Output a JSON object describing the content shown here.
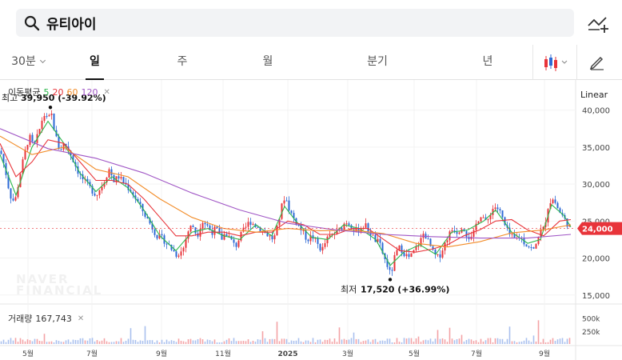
{
  "search": {
    "query": "유티아이",
    "icon": "search-icon"
  },
  "header": {
    "compare_icon": "chart-compare-icon"
  },
  "tabs": [
    {
      "label": "30분",
      "dropdown": true
    },
    {
      "label": "일",
      "active": true
    },
    {
      "label": "주"
    },
    {
      "label": "월"
    },
    {
      "label": "분기"
    },
    {
      "label": "년"
    }
  ],
  "tools": {
    "chart_type_icon": "candlestick-icon",
    "draw_icon": "pencil-icon"
  },
  "scale": {
    "label": "Linear"
  },
  "ma_legend": {
    "label": "이동평균",
    "items": [
      {
        "label": "5",
        "color": "#2db84c"
      },
      {
        "label": "20",
        "color": "#e8343a"
      },
      {
        "label": "60",
        "color": "#f28c28"
      },
      {
        "label": "120",
        "color": "#a056c5"
      }
    ]
  },
  "volume_legend": {
    "label": "거래량",
    "value": "167,743"
  },
  "watermark": {
    "line1": "NAVER",
    "line2": "FINANCIAL"
  },
  "chart_data": {
    "type": "candlestick",
    "ylim": [
      14000,
      43000
    ],
    "y_ticks": [
      {
        "label": "40,000",
        "value": 40000
      },
      {
        "label": "35,000",
        "value": 35000
      },
      {
        "label": "30,000",
        "value": 30000
      },
      {
        "label": "25,000",
        "value": 25000
      },
      {
        "label": "20,000",
        "value": 20000
      },
      {
        "label": "15,000",
        "value": 15000
      }
    ],
    "x_ticks": [
      {
        "label": "5월",
        "x": 35
      },
      {
        "label": "7월",
        "x": 115
      },
      {
        "label": "9월",
        "x": 202
      },
      {
        "label": "11월",
        "x": 279
      },
      {
        "label": "2025",
        "x": 360,
        "bold": true
      },
      {
        "label": "3월",
        "x": 435
      },
      {
        "label": "5월",
        "x": 518
      },
      {
        "label": "7월",
        "x": 596
      },
      {
        "label": "9월",
        "x": 681
      }
    ],
    "x_range": [
      0,
      718
    ],
    "current_price": {
      "label": "24,000",
      "value": 24000,
      "color": "#e8343a"
    },
    "high": {
      "label": "최고",
      "value_label": "39,950 (-39.92%)",
      "value": 39950,
      "x": 63
    },
    "low": {
      "label": "최저",
      "value_label": "17,520 (+36.99%)",
      "value": 17520,
      "x": 488
    },
    "volume_ticks": [
      {
        "label": "500k",
        "value": 500000
      },
      {
        "label": "250k",
        "value": 250000
      }
    ],
    "volume_max": 620000,
    "price_anchors": [
      [
        0,
        34500
      ],
      [
        6,
        32000
      ],
      [
        12,
        28500
      ],
      [
        18,
        27500
      ],
      [
        24,
        31000
      ],
      [
        30,
        34000
      ],
      [
        36,
        36500
      ],
      [
        42,
        35000
      ],
      [
        48,
        37000
      ],
      [
        54,
        39500
      ],
      [
        60,
        38500
      ],
      [
        63,
        39950
      ],
      [
        68,
        37000
      ],
      [
        74,
        34500
      ],
      [
        80,
        35500
      ],
      [
        86,
        34500
      ],
      [
        92,
        33000
      ],
      [
        98,
        31500
      ],
      [
        104,
        30500
      ],
      [
        112,
        29500
      ],
      [
        120,
        28500
      ],
      [
        128,
        30000
      ],
      [
        136,
        32000
      ],
      [
        142,
        30500
      ],
      [
        148,
        31000
      ],
      [
        156,
        30000
      ],
      [
        164,
        29000
      ],
      [
        172,
        27500
      ],
      [
        180,
        26000
      ],
      [
        188,
        24500
      ],
      [
        196,
        23000
      ],
      [
        204,
        22500
      ],
      [
        212,
        21500
      ],
      [
        220,
        20500
      ],
      [
        228,
        21000
      ],
      [
        234,
        23500
      ],
      [
        240,
        24500
      ],
      [
        246,
        23000
      ],
      [
        252,
        25000
      ],
      [
        258,
        24500
      ],
      [
        264,
        23500
      ],
      [
        270,
        24000
      ],
      [
        276,
        22500
      ],
      [
        282,
        23500
      ],
      [
        288,
        22500
      ],
      [
        294,
        21500
      ],
      [
        300,
        23000
      ],
      [
        306,
        24000
      ],
      [
        312,
        25000
      ],
      [
        318,
        24500
      ],
      [
        324,
        24000
      ],
      [
        330,
        23500
      ],
      [
        336,
        23000
      ],
      [
        342,
        22500
      ],
      [
        346,
        24000
      ],
      [
        352,
        27000
      ],
      [
        356,
        28500
      ],
      [
        360,
        27000
      ],
      [
        366,
        25500
      ],
      [
        372,
        24500
      ],
      [
        378,
        23500
      ],
      [
        384,
        22500
      ],
      [
        390,
        23000
      ],
      [
        396,
        22000
      ],
      [
        402,
        21000
      ],
      [
        408,
        22500
      ],
      [
        414,
        23000
      ],
      [
        420,
        23500
      ],
      [
        426,
        24000
      ],
      [
        432,
        25000
      ],
      [
        438,
        24500
      ],
      [
        444,
        23500
      ],
      [
        450,
        24000
      ],
      [
        456,
        24500
      ],
      [
        462,
        23500
      ],
      [
        468,
        22500
      ],
      [
        474,
        22000
      ],
      [
        480,
        20000
      ],
      [
        486,
        18500
      ],
      [
        488,
        17520
      ],
      [
        494,
        20500
      ],
      [
        500,
        21500
      ],
      [
        506,
        20500
      ],
      [
        512,
        20000
      ],
      [
        518,
        21000
      ],
      [
        524,
        22000
      ],
      [
        530,
        23500
      ],
      [
        536,
        22000
      ],
      [
        542,
        20500
      ],
      [
        548,
        20000
      ],
      [
        554,
        21500
      ],
      [
        560,
        23000
      ],
      [
        566,
        24000
      ],
      [
        572,
        23500
      ],
      [
        578,
        24500
      ],
      [
        584,
        23000
      ],
      [
        590,
        22500
      ],
      [
        596,
        25000
      ],
      [
        602,
        26000
      ],
      [
        608,
        24500
      ],
      [
        614,
        26500
      ],
      [
        620,
        27000
      ],
      [
        626,
        26000
      ],
      [
        632,
        24000
      ],
      [
        638,
        23000
      ],
      [
        644,
        22500
      ],
      [
        650,
        23000
      ],
      [
        656,
        22000
      ],
      [
        662,
        21500
      ],
      [
        668,
        21000
      ],
      [
        674,
        23500
      ],
      [
        680,
        24000
      ],
      [
        686,
        27500
      ],
      [
        692,
        28000
      ],
      [
        698,
        26500
      ],
      [
        704,
        25500
      ],
      [
        710,
        24500
      ],
      [
        714,
        24000
      ]
    ],
    "ma_lines": [
      {
        "name": "5",
        "color": "#2db84c",
        "points": [
          [
            0,
            34000
          ],
          [
            20,
            28500
          ],
          [
            40,
            35000
          ],
          [
            60,
            38500
          ],
          [
            80,
            35500
          ],
          [
            100,
            31500
          ],
          [
            120,
            29000
          ],
          [
            140,
            31000
          ],
          [
            160,
            29500
          ],
          [
            180,
            26500
          ],
          [
            200,
            23000
          ],
          [
            220,
            21000
          ],
          [
            240,
            23500
          ],
          [
            260,
            24000
          ],
          [
            280,
            23000
          ],
          [
            300,
            22500
          ],
          [
            320,
            24500
          ],
          [
            340,
            23000
          ],
          [
            356,
            27000
          ],
          [
            370,
            25000
          ],
          [
            390,
            22800
          ],
          [
            410,
            22500
          ],
          [
            430,
            24500
          ],
          [
            450,
            24000
          ],
          [
            470,
            22500
          ],
          [
            488,
            19000
          ],
          [
            505,
            20800
          ],
          [
            525,
            21800
          ],
          [
            545,
            20500
          ],
          [
            565,
            23500
          ],
          [
            585,
            23800
          ],
          [
            605,
            25000
          ],
          [
            620,
            26500
          ],
          [
            640,
            23500
          ],
          [
            660,
            22000
          ],
          [
            676,
            22500
          ],
          [
            690,
            27200
          ],
          [
            705,
            25800
          ],
          [
            714,
            24200
          ]
        ]
      },
      {
        "name": "20",
        "color": "#e8343a",
        "points": [
          [
            0,
            35500
          ],
          [
            20,
            31000
          ],
          [
            40,
            33000
          ],
          [
            60,
            36000
          ],
          [
            80,
            35500
          ],
          [
            100,
            33000
          ],
          [
            120,
            30500
          ],
          [
            140,
            30500
          ],
          [
            160,
            30000
          ],
          [
            180,
            28000
          ],
          [
            200,
            25500
          ],
          [
            220,
            23000
          ],
          [
            240,
            23000
          ],
          [
            260,
            23500
          ],
          [
            280,
            23500
          ],
          [
            300,
            23000
          ],
          [
            320,
            23500
          ],
          [
            340,
            23500
          ],
          [
            360,
            25000
          ],
          [
            380,
            24500
          ],
          [
            400,
            23200
          ],
          [
            420,
            23200
          ],
          [
            440,
            24000
          ],
          [
            460,
            24000
          ],
          [
            480,
            22500
          ],
          [
            500,
            21000
          ],
          [
            520,
            20800
          ],
          [
            540,
            21200
          ],
          [
            560,
            21800
          ],
          [
            580,
            23000
          ],
          [
            600,
            23800
          ],
          [
            620,
            25000
          ],
          [
            640,
            25200
          ],
          [
            660,
            23800
          ],
          [
            680,
            23000
          ],
          [
            700,
            25000
          ],
          [
            714,
            25200
          ]
        ]
      },
      {
        "name": "60",
        "color": "#f28c28",
        "points": [
          [
            0,
            36500
          ],
          [
            40,
            34000
          ],
          [
            80,
            35000
          ],
          [
            120,
            32000
          ],
          [
            160,
            31000
          ],
          [
            200,
            28000
          ],
          [
            240,
            25500
          ],
          [
            280,
            24000
          ],
          [
            320,
            23500
          ],
          [
            360,
            24000
          ],
          [
            400,
            23700
          ],
          [
            440,
            23800
          ],
          [
            480,
            23300
          ],
          [
            520,
            22000
          ],
          [
            560,
            21500
          ],
          [
            600,
            22200
          ],
          [
            640,
            23400
          ],
          [
            680,
            23800
          ],
          [
            714,
            24500
          ]
        ]
      },
      {
        "name": "120",
        "color": "#a056c5",
        "points": [
          [
            0,
            37500
          ],
          [
            60,
            34800
          ],
          [
            120,
            33500
          ],
          [
            180,
            31500
          ],
          [
            240,
            28800
          ],
          [
            300,
            26500
          ],
          [
            360,
            24700
          ],
          [
            420,
            23800
          ],
          [
            480,
            23200
          ],
          [
            540,
            22900
          ],
          [
            600,
            22700
          ],
          [
            660,
            22700
          ],
          [
            714,
            23200
          ]
        ]
      }
    ]
  }
}
